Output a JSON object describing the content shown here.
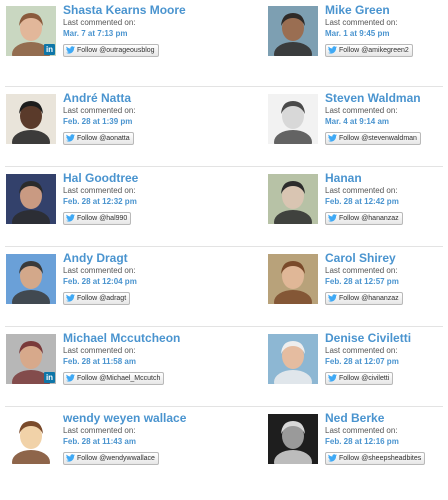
{
  "meta_label": "Last commented on:",
  "follow_prefix": "Follow",
  "rows": [
    [
      {
        "name": "Shasta Kearns Moore",
        "date": "Mar. 7 at 7:13 pm",
        "handle": "@outrageousblog",
        "linkedin": true,
        "palette": [
          "#c9d7c1",
          "#e2b79a",
          "#8a5a3c"
        ]
      },
      {
        "name": "Mike Green",
        "date": "Mar. 1 at 9:45 pm",
        "handle": "@amikegreen2",
        "linkedin": false,
        "palette": [
          "#7d9fb2",
          "#9a6e52",
          "#2e2a28"
        ]
      }
    ],
    [
      {
        "name": "André Natta",
        "date": "Feb. 28 at 1:39 pm",
        "handle": "@aonatta",
        "linkedin": false,
        "palette": [
          "#e9e4da",
          "#5a3a2a",
          "#1d1d1d"
        ]
      },
      {
        "name": "Steven Waldman",
        "date": "Mar. 4 at 9:14 am",
        "handle": "@stevenwaldman",
        "linkedin": false,
        "palette": [
          "#f2f2f2",
          "#d8d8d8",
          "#4a4a4a"
        ]
      }
    ],
    [
      {
        "name": "Hal Goodtree",
        "date": "Feb. 28 at 12:32 pm",
        "handle": "@hal990",
        "linkedin": false,
        "palette": [
          "#33416b",
          "#c99a82",
          "#2b2b2b"
        ]
      },
      {
        "name": "Hanan",
        "date": "Feb. 28 at 12:42 pm",
        "handle": "@hananzaz",
        "linkedin": false,
        "palette": [
          "#b7c2a6",
          "#d9c5b2",
          "#2c2c2c"
        ]
      }
    ],
    [
      {
        "name": "Andy Dragt",
        "date": "Feb. 28 at 12:04 pm",
        "handle": "@adragt",
        "linkedin": false,
        "palette": [
          "#6aa0d8",
          "#d3a88a",
          "#3a3a3a"
        ]
      },
      {
        "name": "Carol Shirey",
        "date": "Feb. 28 at 12:57 pm",
        "handle": "@hananzaz",
        "linkedin": false,
        "palette": [
          "#b8a27a",
          "#e0b797",
          "#7a4a2a"
        ]
      }
    ],
    [
      {
        "name": "Michael Mccutcheon",
        "date": "Feb. 28 at 11:58 am",
        "handle": "@Michael_Mccutch",
        "linkedin": true,
        "palette": [
          "#b7b7b7",
          "#d7a98b",
          "#7a3a3a"
        ]
      },
      {
        "name": "Denise Civiletti",
        "date": "Feb. 28 at 12:07 pm",
        "handle": "@civiletti",
        "linkedin": false,
        "palette": [
          "#8db7d3",
          "#e5bca0",
          "#eeeeee"
        ]
      }
    ],
    [
      {
        "name": "wendy weyen wallace",
        "date": "Feb. 28 at 11:43 am",
        "handle": "@wendywwallace",
        "linkedin": false,
        "palette": [
          "#ffffff",
          "#f1d2a8",
          "#7a4a2a"
        ]
      },
      {
        "name": "Ned Berke",
        "date": "Feb. 28 at 12:16 pm",
        "handle": "@sheepsheadbites",
        "linkedin": false,
        "palette": [
          "#1e1e1e",
          "#9a9a9a",
          "#d8d8d8"
        ]
      }
    ]
  ]
}
